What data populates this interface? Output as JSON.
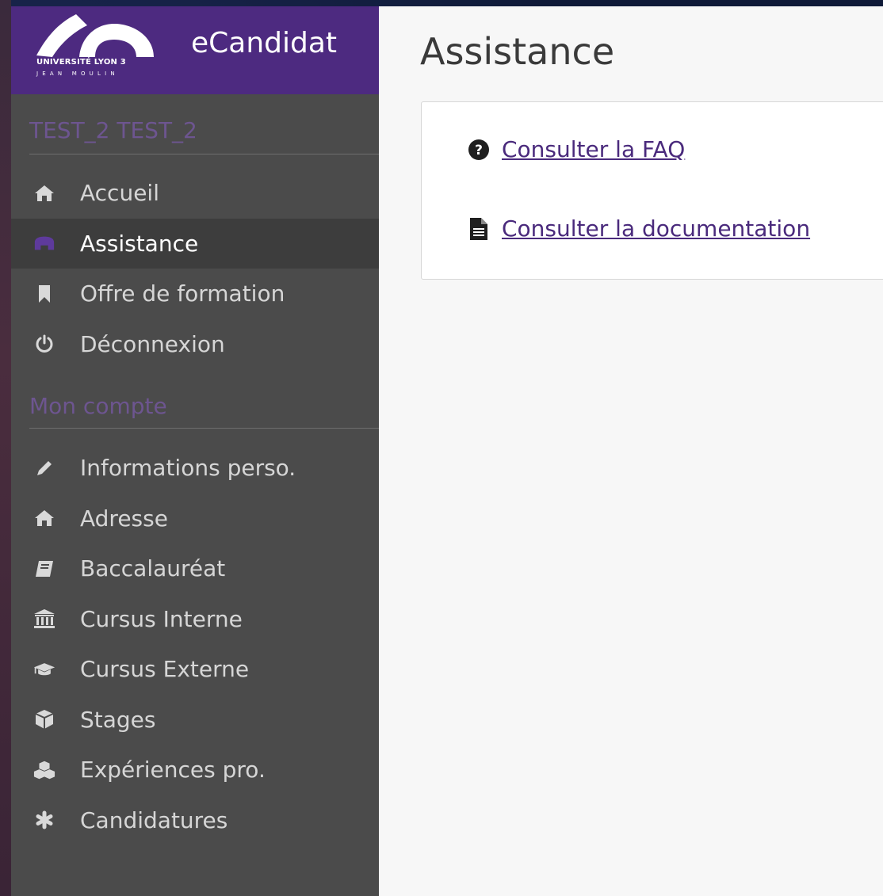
{
  "brand": {
    "logo_line1": "UNIVERSITÉ LYON 3",
    "logo_line2": "JEAN MOULIN",
    "app_title": "eCandidat"
  },
  "sidebar": {
    "user_section": "TEST_2 TEST_2",
    "main_items": [
      {
        "label": "Accueil",
        "icon": "home-icon"
      },
      {
        "label": "Assistance",
        "icon": "life-ring-icon",
        "active": true
      },
      {
        "label": "Offre de formation",
        "icon": "bookmark-icon"
      },
      {
        "label": "Déconnexion",
        "icon": "power-icon"
      }
    ],
    "account_section": "Mon compte",
    "account_items": [
      {
        "label": "Informations perso.",
        "icon": "pencil-icon"
      },
      {
        "label": "Adresse",
        "icon": "home-icon"
      },
      {
        "label": "Baccalauréat",
        "icon": "book-icon"
      },
      {
        "label": "Cursus Interne",
        "icon": "institution-icon"
      },
      {
        "label": "Cursus Externe",
        "icon": "graduation-cap-icon"
      },
      {
        "label": "Stages",
        "icon": "cube-icon"
      },
      {
        "label": "Expériences pro.",
        "icon": "cubes-icon"
      },
      {
        "label": "Candidatures",
        "icon": "asterisk-icon"
      }
    ]
  },
  "main": {
    "title": "Assistance",
    "links": [
      {
        "label": "Consulter la FAQ",
        "icon": "question-circle-icon"
      },
      {
        "label": "Consulter la documentation",
        "icon": "file-text-icon"
      }
    ]
  },
  "colors": {
    "brand": "#4d2a80",
    "sidebar": "#4b4b4b",
    "sidebar_active": "#3d3d3d",
    "section_header": "#6d5590",
    "link": "#4a2a7c"
  }
}
